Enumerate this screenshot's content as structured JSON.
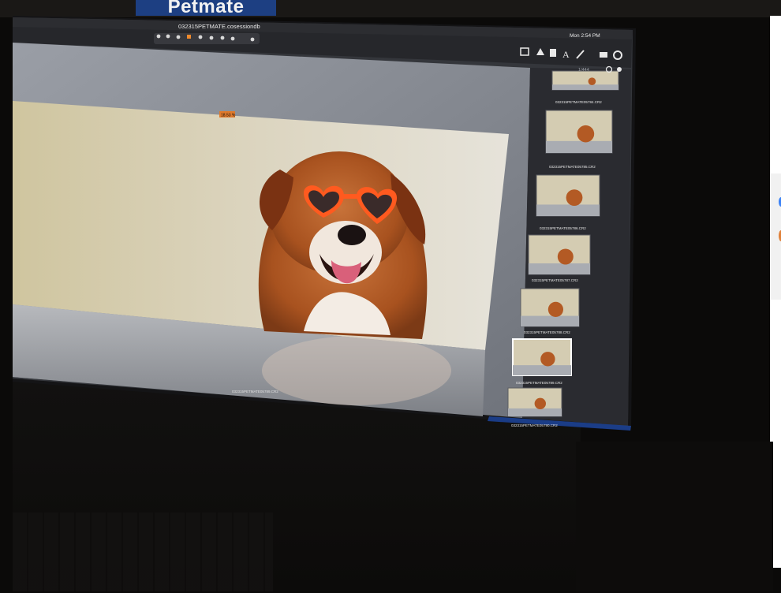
{
  "background": {
    "logo_text": "Petmate"
  },
  "app": {
    "window_title": "032315PETMATE.cosessiondb",
    "menubar_clock": "Mon 2:54 PM",
    "image_counter": "1/444",
    "badge_value": "18.53 %",
    "viewer_caption": "032315PETMATE05789.CR2"
  },
  "thumbnails": [
    {
      "caption": "032315PETMATE05784.CR2"
    },
    {
      "caption": "032315PETMATE05785.CR2"
    },
    {
      "caption": "032315PETMATE05786.CR2"
    },
    {
      "caption": "032315PETMATE05787.CR2"
    },
    {
      "caption": "032315PETMATE05788.CR2"
    },
    {
      "caption": "032315PETMATE05789.CR2"
    },
    {
      "caption": "032315PETMATE05790.CR2"
    }
  ],
  "colors": {
    "screen_bg": "#5d6066",
    "backdrop": "#d8d2bf",
    "dog_fur": "#b8612a",
    "sunglasses": "#ff5a1f",
    "accent_blue": "#1e4fb8"
  },
  "icons": [
    "cursor-icon",
    "hand-icon",
    "zoom-icon",
    "crop-icon",
    "rotate-icon",
    "keystone-icon",
    "spot-icon",
    "picker-icon",
    "eyedropper-icon",
    "grid-icon",
    "warning-icon",
    "library-icon",
    "text-icon",
    "brush-icon",
    "print-icon",
    "settings-icon",
    "search-icon",
    "user-icon"
  ]
}
